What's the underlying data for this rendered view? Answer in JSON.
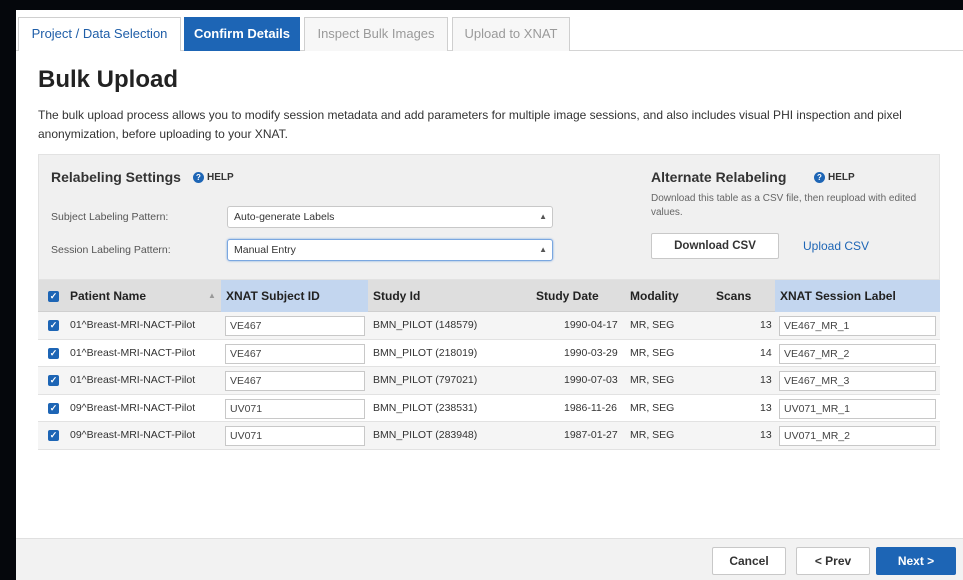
{
  "tabs": [
    {
      "label": "Project / Data Selection"
    },
    {
      "label": "Confirm Details"
    },
    {
      "label": "Inspect Bulk Images"
    },
    {
      "label": "Upload to XNAT"
    }
  ],
  "page": {
    "title": "Bulk Upload",
    "intro": "The bulk upload process allows you to modify session metadata and add parameters for multiple image sessions, and also includes visual PHI inspection and pixel anonymization, before uploading to your XNAT."
  },
  "relabeling": {
    "title": "Relabeling Settings",
    "help": "HELP",
    "subject_label": "Subject Labeling Pattern:",
    "subject_value": "Auto-generate Labels",
    "session_label": "Session Labeling Pattern:",
    "session_value": "Manual Entry"
  },
  "alternate": {
    "title": "Alternate Relabeling",
    "help": "HELP",
    "description": "Download this table as a CSV file, then reupload with edited values.",
    "download_label": "Download CSV",
    "upload_label": "Upload CSV"
  },
  "table": {
    "headers": {
      "patient_name": "Patient Name",
      "subject_id": "XNAT Subject ID",
      "study_id": "Study Id",
      "study_date": "Study Date",
      "modality": "Modality",
      "scans": "Scans",
      "session_label": "XNAT Session Label"
    },
    "rows": [
      {
        "patient": "01^Breast-MRI-NACT-Pilot",
        "subject": "VE467",
        "study": "BMN_PILOT (148579)",
        "date": "1990-04-17",
        "modality": "MR, SEG",
        "scans": "13",
        "session": "VE467_MR_1"
      },
      {
        "patient": "01^Breast-MRI-NACT-Pilot",
        "subject": "VE467",
        "study": "BMN_PILOT (218019)",
        "date": "1990-03-29",
        "modality": "MR, SEG",
        "scans": "14",
        "session": "VE467_MR_2"
      },
      {
        "patient": "01^Breast-MRI-NACT-Pilot",
        "subject": "VE467",
        "study": "BMN_PILOT (797021)",
        "date": "1990-07-03",
        "modality": "MR, SEG",
        "scans": "13",
        "session": "VE467_MR_3"
      },
      {
        "patient": "09^Breast-MRI-NACT-Pilot",
        "subject": "UV071",
        "study": "BMN_PILOT (238531)",
        "date": "1986-11-26",
        "modality": "MR, SEG",
        "scans": "13",
        "session": "UV071_MR_1"
      },
      {
        "patient": "09^Breast-MRI-NACT-Pilot",
        "subject": "UV071",
        "study": "BMN_PILOT (283948)",
        "date": "1987-01-27",
        "modality": "MR, SEG",
        "scans": "13",
        "session": "UV071_MR_2"
      }
    ]
  },
  "footer": {
    "cancel_label": "Cancel",
    "prev_label": "< Prev",
    "next_label": "Next >"
  },
  "icons": {
    "help": "help-circle-icon",
    "checkbox": "checkbox-checked-icon",
    "sort": "sort-asc-icon",
    "select_arrows": "select-arrows-icon"
  },
  "colors": {
    "accent": "#1d65b5",
    "header_highlight": "#c3d6ef",
    "page_bg": "#05070c"
  }
}
